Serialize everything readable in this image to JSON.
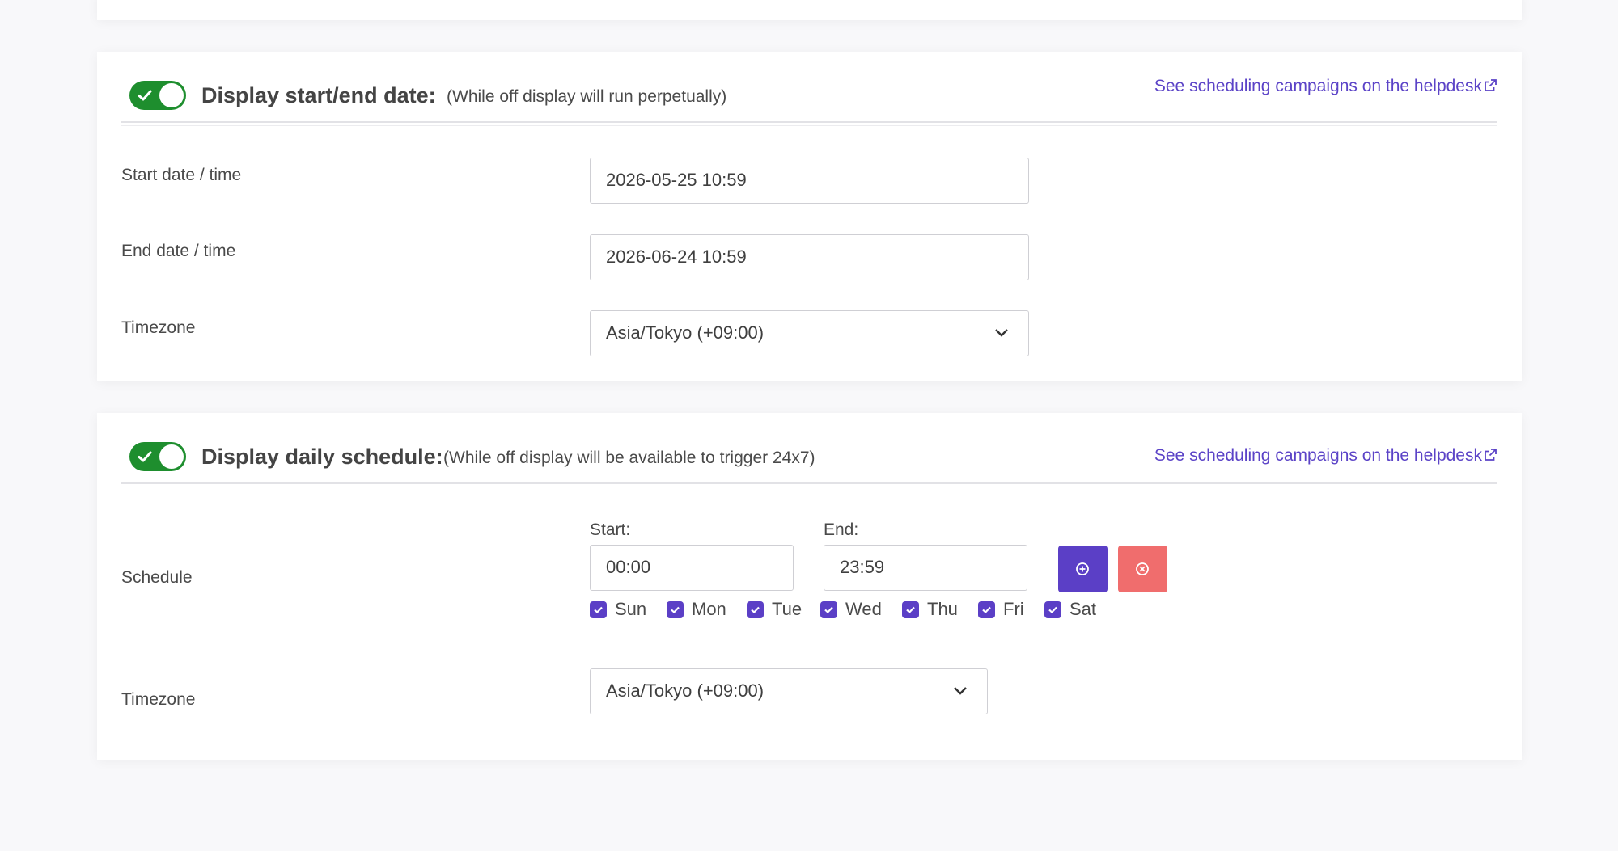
{
  "date_section": {
    "toggle_on": true,
    "title": "Display start/end date:",
    "note": "(While off display will run perpetually)",
    "help_link": "See scheduling campaigns on the helpdesk",
    "start_label": "Start date / time",
    "start_value": "2026-05-25 10:59",
    "end_label": "End date / time",
    "end_value": "2026-06-24 10:59",
    "timezone_label": "Timezone",
    "timezone_value": "Asia/Tokyo (+09:00)"
  },
  "schedule_section": {
    "toggle_on": true,
    "title": "Display daily schedule:",
    "note": "(While off display will be available to trigger 24x7)",
    "help_link": "See scheduling campaigns on the helpdesk",
    "schedule_label": "Schedule",
    "start_label": "Start:",
    "start_value": "00:00",
    "end_label": "End:",
    "end_value": "23:59",
    "days": [
      {
        "label": "Sun",
        "checked": true
      },
      {
        "label": "Mon",
        "checked": true
      },
      {
        "label": "Tue",
        "checked": true
      },
      {
        "label": "Wed",
        "checked": true
      },
      {
        "label": "Thu",
        "checked": true
      },
      {
        "label": "Fri",
        "checked": true
      },
      {
        "label": "Sat",
        "checked": true
      }
    ],
    "timezone_label": "Timezone",
    "timezone_value": "Asia/Tokyo (+09:00)"
  },
  "colors": {
    "toggle_on": "#1e8e2e",
    "accent": "#5b3fc6",
    "link": "#5b43c7",
    "danger": "#f06d6d"
  },
  "icons": {
    "toggle_check": "check-icon",
    "external_link": "external-link-icon",
    "select_arrow": "chevron-down-icon",
    "add": "plus-circle-icon",
    "remove": "x-circle-icon"
  }
}
